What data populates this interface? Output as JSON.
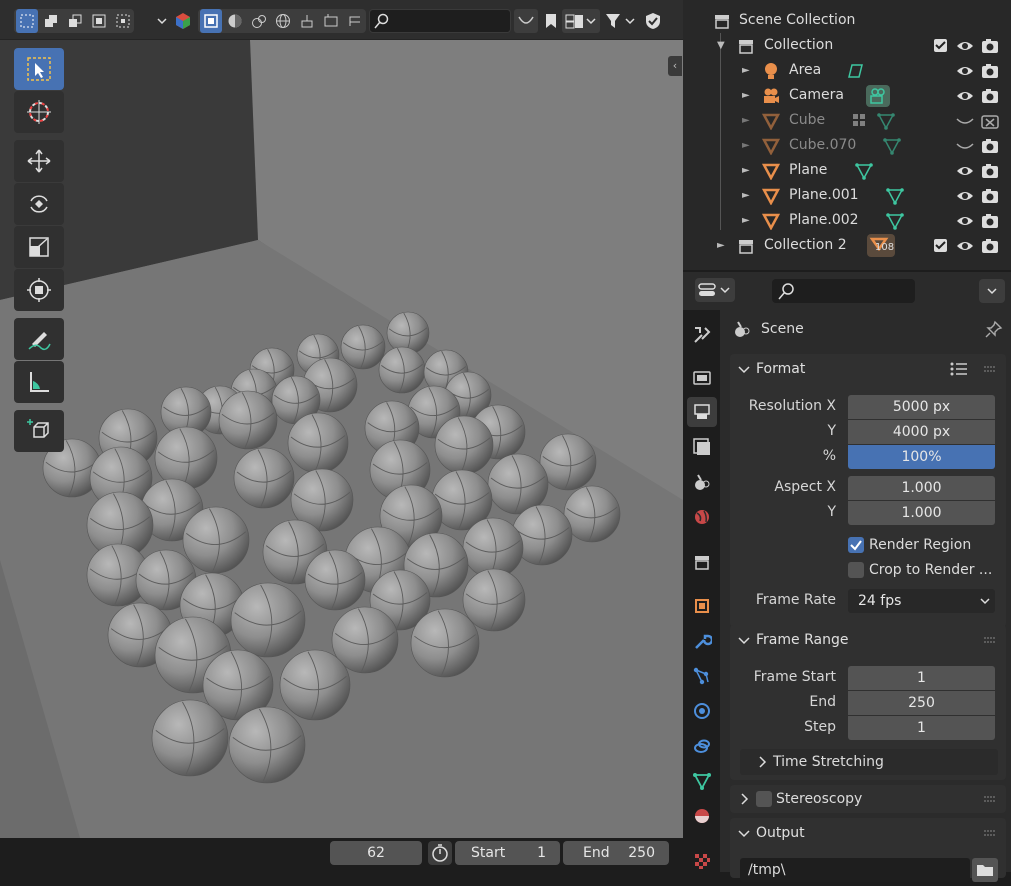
{
  "viewport_header": {
    "search_placeholder": ""
  },
  "timeline": {
    "current_frame": "62",
    "start_label": "Start",
    "start_value": "1",
    "end_label": "End",
    "end_value": "250"
  },
  "outliner": {
    "root": "Scene Collection",
    "items": [
      {
        "label": "Collection"
      },
      {
        "label": "Area"
      },
      {
        "label": "Camera"
      },
      {
        "label": "Cube"
      },
      {
        "label": "Cube.070"
      },
      {
        "label": "Plane"
      },
      {
        "label": "Plane.001"
      },
      {
        "label": "Plane.002"
      },
      {
        "label": "Collection 2",
        "badge": "108"
      }
    ]
  },
  "properties": {
    "scene_title": "Scene",
    "format": {
      "title": "Format",
      "res_x_label": "Resolution X",
      "res_x": "5000 px",
      "res_y_label": "Y",
      "res_y": "4000 px",
      "pct_label": "%",
      "pct": "100%",
      "aspect_x_label": "Aspect X",
      "aspect_x": "1.000",
      "aspect_y_label": "Y",
      "aspect_y": "1.000",
      "render_region": "Render Region",
      "crop": "Crop to Render ...",
      "frame_rate_label": "Frame Rate",
      "frame_rate": "24 fps"
    },
    "frame_range": {
      "title": "Frame Range",
      "start_label": "Frame Start",
      "start": "1",
      "end_label": "End",
      "end": "250",
      "step_label": "Step",
      "step": "1",
      "time_stretching": "Time Stretching"
    },
    "stereoscopy": "Stereoscopy",
    "output": {
      "title": "Output",
      "path": "/tmp\\"
    }
  },
  "colors": {
    "accent": "#4772b3",
    "object_orange": "#e98f4b",
    "mesh_green": "#3ec7a1"
  }
}
